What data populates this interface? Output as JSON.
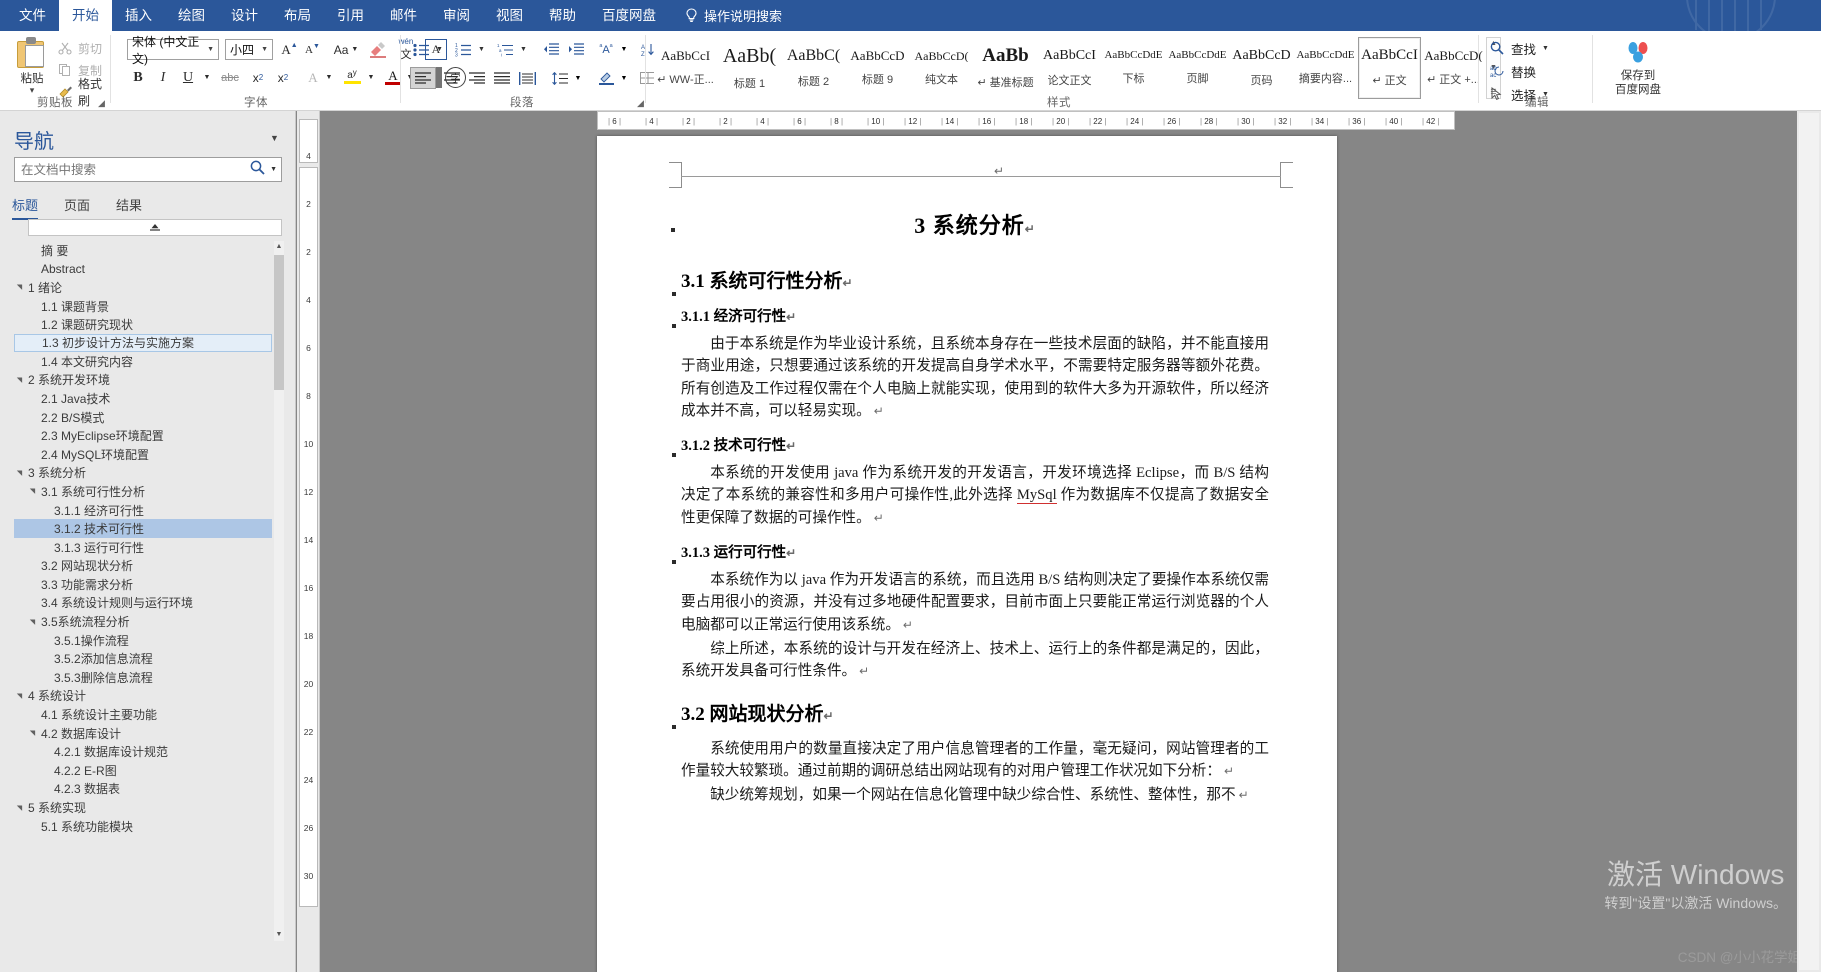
{
  "menu": {
    "tabs": [
      {
        "label": "文件",
        "active": false
      },
      {
        "label": "开始",
        "active": true
      },
      {
        "label": "插入",
        "active": false
      },
      {
        "label": "绘图",
        "active": false
      },
      {
        "label": "设计",
        "active": false
      },
      {
        "label": "布局",
        "active": false
      },
      {
        "label": "引用",
        "active": false
      },
      {
        "label": "邮件",
        "active": false
      },
      {
        "label": "审阅",
        "active": false
      },
      {
        "label": "视图",
        "active": false
      },
      {
        "label": "帮助",
        "active": false
      },
      {
        "label": "百度网盘",
        "active": false
      }
    ],
    "tell_me": "操作说明搜索"
  },
  "ribbon": {
    "groups": [
      {
        "name": "剪贴板"
      },
      {
        "name": "字体"
      },
      {
        "name": "段落"
      },
      {
        "name": "样式"
      },
      {
        "name": "编辑"
      }
    ],
    "clipboard": {
      "paste_label": "粘贴",
      "cut_label": "剪切",
      "copy_label": "复制",
      "format_painter_label": "格式刷"
    },
    "font": {
      "family_value": "宋体 (中文正文)",
      "size_value": "小四"
    },
    "styles": [
      {
        "preview": "AaBbCcI",
        "name": "↵ WW-正...",
        "size": 13,
        "bold": false,
        "selected": false
      },
      {
        "preview": "AaBb(",
        "name": "标题 1",
        "size": 20,
        "bold": false,
        "selected": false
      },
      {
        "preview": "AaBbC(",
        "name": "标题 2",
        "size": 16,
        "bold": false,
        "selected": false
      },
      {
        "preview": "AaBbCcD",
        "name": "标题 9",
        "size": 13,
        "bold": false,
        "selected": false
      },
      {
        "preview": "AaBbCcD(",
        "name": "纯文本",
        "size": 12,
        "bold": false,
        "selected": false
      },
      {
        "preview": "AaBb",
        "name": "↵ 基准标题",
        "size": 19,
        "bold": true,
        "selected": false
      },
      {
        "preview": "AaBbCcI",
        "name": "论文正文",
        "size": 14,
        "bold": false,
        "selected": false
      },
      {
        "preview": "AaBbCcDdE",
        "name": "下标",
        "size": 11,
        "bold": false,
        "selected": false
      },
      {
        "preview": "AaBbCcDdE",
        "name": "页脚",
        "size": 11,
        "bold": false,
        "selected": false
      },
      {
        "preview": "AaBbCcD",
        "name": "页码",
        "size": 14,
        "bold": false,
        "selected": false
      },
      {
        "preview": "AaBbCcDdE",
        "name": "摘要内容...",
        "size": 11,
        "bold": false,
        "selected": false
      },
      {
        "preview": "AaBbCcI",
        "name": "↵ 正文",
        "size": 15,
        "bold": false,
        "selected": true
      },
      {
        "preview": "AaBbCcD(",
        "name": "↵ 正文 +...",
        "size": 13,
        "bold": false,
        "selected": false
      }
    ],
    "editing": {
      "find_label": "查找",
      "replace_label": "替换",
      "select_label": "选择"
    },
    "baidu": {
      "line1": "保存到",
      "line2": "百度网盘"
    }
  },
  "navigation": {
    "title": "导航",
    "search_placeholder": "在文档中搜索",
    "search_value": "",
    "tabs": [
      {
        "label": "标题",
        "active": true
      },
      {
        "label": "页面",
        "active": false
      },
      {
        "label": "结果",
        "active": false
      }
    ],
    "headings": [
      {
        "label": "摘 要",
        "indent": 1,
        "tri": "",
        "state": "none"
      },
      {
        "label": "Abstract",
        "indent": 1,
        "tri": "",
        "state": "none"
      },
      {
        "label": "1 绪论",
        "indent": 0,
        "tri": "▲",
        "state": "none"
      },
      {
        "label": "1.1 课题背景",
        "indent": 1,
        "tri": "",
        "state": "none"
      },
      {
        "label": "1.2 课题研究现状",
        "indent": 1,
        "tri": "",
        "state": "none"
      },
      {
        "label": "1.3 初步设计方法与实施方案",
        "indent": 1,
        "tri": "",
        "state": "hover"
      },
      {
        "label": "1.4 本文研究内容",
        "indent": 1,
        "tri": "",
        "state": "none"
      },
      {
        "label": "2 系统开发环境",
        "indent": 0,
        "tri": "▲",
        "state": "none"
      },
      {
        "label": "2.1 Java技术",
        "indent": 1,
        "tri": "",
        "state": "none"
      },
      {
        "label": "2.2 B/S模式",
        "indent": 1,
        "tri": "",
        "state": "none"
      },
      {
        "label": "2.3 MyEclipse环境配置",
        "indent": 1,
        "tri": "",
        "state": "none"
      },
      {
        "label": "2.4 MySQL环境配置",
        "indent": 1,
        "tri": "",
        "state": "none"
      },
      {
        "label": "3 系统分析",
        "indent": 0,
        "tri": "▲",
        "state": "none"
      },
      {
        "label": "3.1 系统可行性分析",
        "indent": 1,
        "tri": "▲",
        "state": "none"
      },
      {
        "label": "3.1.1 经济可行性",
        "indent": 2,
        "tri": "",
        "state": "none"
      },
      {
        "label": "3.1.2 技术可行性",
        "indent": 2,
        "tri": "",
        "state": "selected"
      },
      {
        "label": "3.1.3 运行可行性",
        "indent": 2,
        "tri": "",
        "state": "none"
      },
      {
        "label": "3.2 网站现状分析",
        "indent": 1,
        "tri": "",
        "state": "none"
      },
      {
        "label": "3.3 功能需求分析",
        "indent": 1,
        "tri": "",
        "state": "none"
      },
      {
        "label": "3.4 系统设计规则与运行环境",
        "indent": 1,
        "tri": "",
        "state": "none"
      },
      {
        "label": "3.5系统流程分析",
        "indent": 1,
        "tri": "▲",
        "state": "none"
      },
      {
        "label": "3.5.1操作流程",
        "indent": 2,
        "tri": "",
        "state": "none"
      },
      {
        "label": "3.5.2添加信息流程",
        "indent": 2,
        "tri": "",
        "state": "none"
      },
      {
        "label": "3.5.3删除信息流程",
        "indent": 2,
        "tri": "",
        "state": "none"
      },
      {
        "label": "4 系统设计",
        "indent": 0,
        "tri": "▲",
        "state": "none"
      },
      {
        "label": "4.1 系统设计主要功能",
        "indent": 1,
        "tri": "",
        "state": "none"
      },
      {
        "label": "4.2 数据库设计",
        "indent": 1,
        "tri": "▲",
        "state": "none"
      },
      {
        "label": "4.2.1 数据库设计规范",
        "indent": 2,
        "tri": "",
        "state": "none"
      },
      {
        "label": "4.2.2 E-R图",
        "indent": 2,
        "tri": "",
        "state": "none"
      },
      {
        "label": "4.2.3 数据表",
        "indent": 2,
        "tri": "",
        "state": "none"
      },
      {
        "label": "5 系统实现",
        "indent": 0,
        "tri": "▲",
        "state": "none"
      },
      {
        "label": "5.1  系统功能模块",
        "indent": 1,
        "tri": "",
        "state": "none"
      }
    ]
  },
  "vertical_ruler": {
    "ticks": [
      "4",
      "2",
      "2",
      "4",
      "6",
      "8",
      "10",
      "12",
      "14",
      "16",
      "18",
      "20",
      "22",
      "24",
      "26",
      "30"
    ]
  },
  "horizontal_ruler": {
    "ticks": [
      "6",
      "4",
      "2",
      "2",
      "4",
      "6",
      "8",
      "10",
      "12",
      "14",
      "16",
      "18",
      "20",
      "22",
      "24",
      "26",
      "28",
      "30",
      "32",
      "34",
      "36",
      "40",
      "42"
    ]
  },
  "document": {
    "chapter_title": "3  系统分析",
    "blocks": [
      {
        "type": "h2",
        "text": "3.1  系统可行性分析"
      },
      {
        "type": "h3",
        "text": "3.1.1  经济可行性"
      },
      {
        "type": "p",
        "text": "由于本系统是作为毕业设计系统，且系统本身存在一些技术层面的缺陷，并不能直接用于商业用途，只想要通过该系统的开发提高自身学术水平，不需要特定服务器等额外花费。所有创造及工作过程仅需在个人电脑上就能实现，使用到的软件大多为开源软件，所以经济成本并不高，可以轻易实现。"
      },
      {
        "type": "h3",
        "text": "3.1.2  技术可行性"
      },
      {
        "type": "p",
        "text": "本系统的开发使用 java 作为系统开发的开发语言，开发环境选择 Eclipse，而 B/S 结构决定了本系统的兼容性和多用户可操作性,此外选择 MySql 作为数据库不仅提高了数据安全性更保障了数据的可操作性。"
      },
      {
        "type": "h3",
        "text": "3.1.3  运行可行性"
      },
      {
        "type": "p",
        "text": "本系统作为以 java 作为开发语言的系统，而且选用 B/S 结构则决定了要操作本系统仅需要占用很小的资源，并没有过多地硬件配置要求，目前市面上只要能正常运行浏览器的个人电脑都可以正常运行使用该系统。"
      },
      {
        "type": "p",
        "text": "综上所述，本系统的设计与开发在经济上、技术上、运行上的条件都是满足的，因此，系统开发具备可行性条件。"
      },
      {
        "type": "h2",
        "text": "3.2  网站现状分析"
      },
      {
        "type": "p",
        "text": "系统使用用户的数量直接决定了用户信息管理者的工作量，毫无疑问，网站管理者的工作量较大较繁琐。通过前期的调研总结出网站现有的对用户管理工作状况如下分析："
      },
      {
        "type": "p",
        "text": "缺少统筹规划，如果一个网站在信息化管理中缺少综合性、系统性、整体性，那不"
      }
    ]
  },
  "watermark": {
    "line1": "激活 Windows",
    "line2": "转到\"设置\"以激活 Windows。"
  },
  "credit": "CSDN @小小花学姐"
}
